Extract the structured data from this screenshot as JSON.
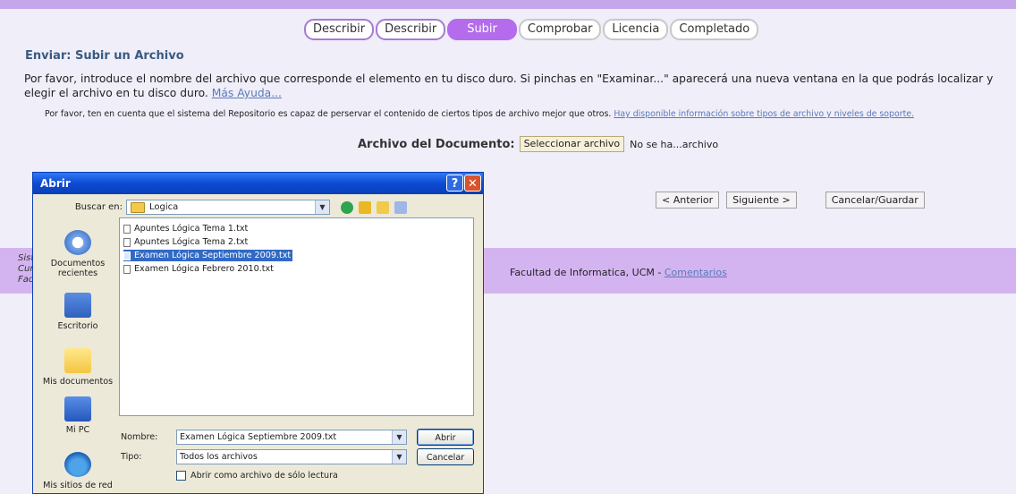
{
  "wizard_steps": [
    {
      "label": "Describir",
      "state": "done"
    },
    {
      "label": "Describir",
      "state": "done"
    },
    {
      "label": "Subir",
      "state": "active"
    },
    {
      "label": "Comprobar",
      "state": "pending"
    },
    {
      "label": "Licencia",
      "state": "pending"
    },
    {
      "label": "Completado",
      "state": "pending"
    }
  ],
  "section_title": "Enviar: Subir un Archivo",
  "intro": {
    "text": "Por favor, introduce el nombre del archivo que corresponde el elemento en tu disco duro. Si pinchas en \"Examinar...\" aparecerá una nueva ventana en la que podrás localizar y elegir el archivo en tu disco duro.",
    "help_link": "Más Ayuda..."
  },
  "note": {
    "text": "Por favor, ten en cuenta que el sistema del Repositorio es capaz de perservar el contenido de ciertos tipos de archivo mejor que otros.",
    "link": "Hay disponible información sobre tipos de archivo y niveles de soporte."
  },
  "file_field": {
    "label": "Archivo del Documento:",
    "button": "Seleccionar archivo",
    "status": "No se ha...archivo"
  },
  "nav": {
    "previous": "< Anterior",
    "next": "Siguiente >",
    "cancel": "Cancelar/Guardar"
  },
  "footer": {
    "left_lines": [
      "Sist",
      "Cur",
      "Fac"
    ],
    "text": "Facultad de Informatica, UCM  - ",
    "link": "Comentarios"
  },
  "dialog": {
    "title": "Abrir",
    "help_glyph": "?",
    "close_glyph": "✕",
    "look_in_label": "Buscar en:",
    "look_in_value": "Logica",
    "places": [
      {
        "label": "Documentos recientes",
        "icon": "recent-documents-icon"
      },
      {
        "label": "Escritorio",
        "icon": "desktop-icon"
      },
      {
        "label": "Mis documentos",
        "icon": "my-documents-icon"
      },
      {
        "label": "Mi PC",
        "icon": "my-computer-icon"
      },
      {
        "label": "Mis sitios de red",
        "icon": "network-places-icon"
      }
    ],
    "files": [
      {
        "name": "Apuntes Lógica Tema 1.txt",
        "selected": false
      },
      {
        "name": "Apuntes Lógica Tema 2.txt",
        "selected": false
      },
      {
        "name": "Examen Lógica Septiembre 2009.txt",
        "selected": true
      },
      {
        "name": "Examen Lógica Febrero 2010.txt",
        "selected": false
      }
    ],
    "filename_label": "Nombre:",
    "filename_value": "Examen Lógica Septiembre 2009.txt",
    "type_label": "Tipo:",
    "type_value": "Todos los archivos",
    "open_button": "Abrir",
    "cancel_button": "Cancelar",
    "readonly_label": "Abrir como archivo de sólo lectura"
  }
}
